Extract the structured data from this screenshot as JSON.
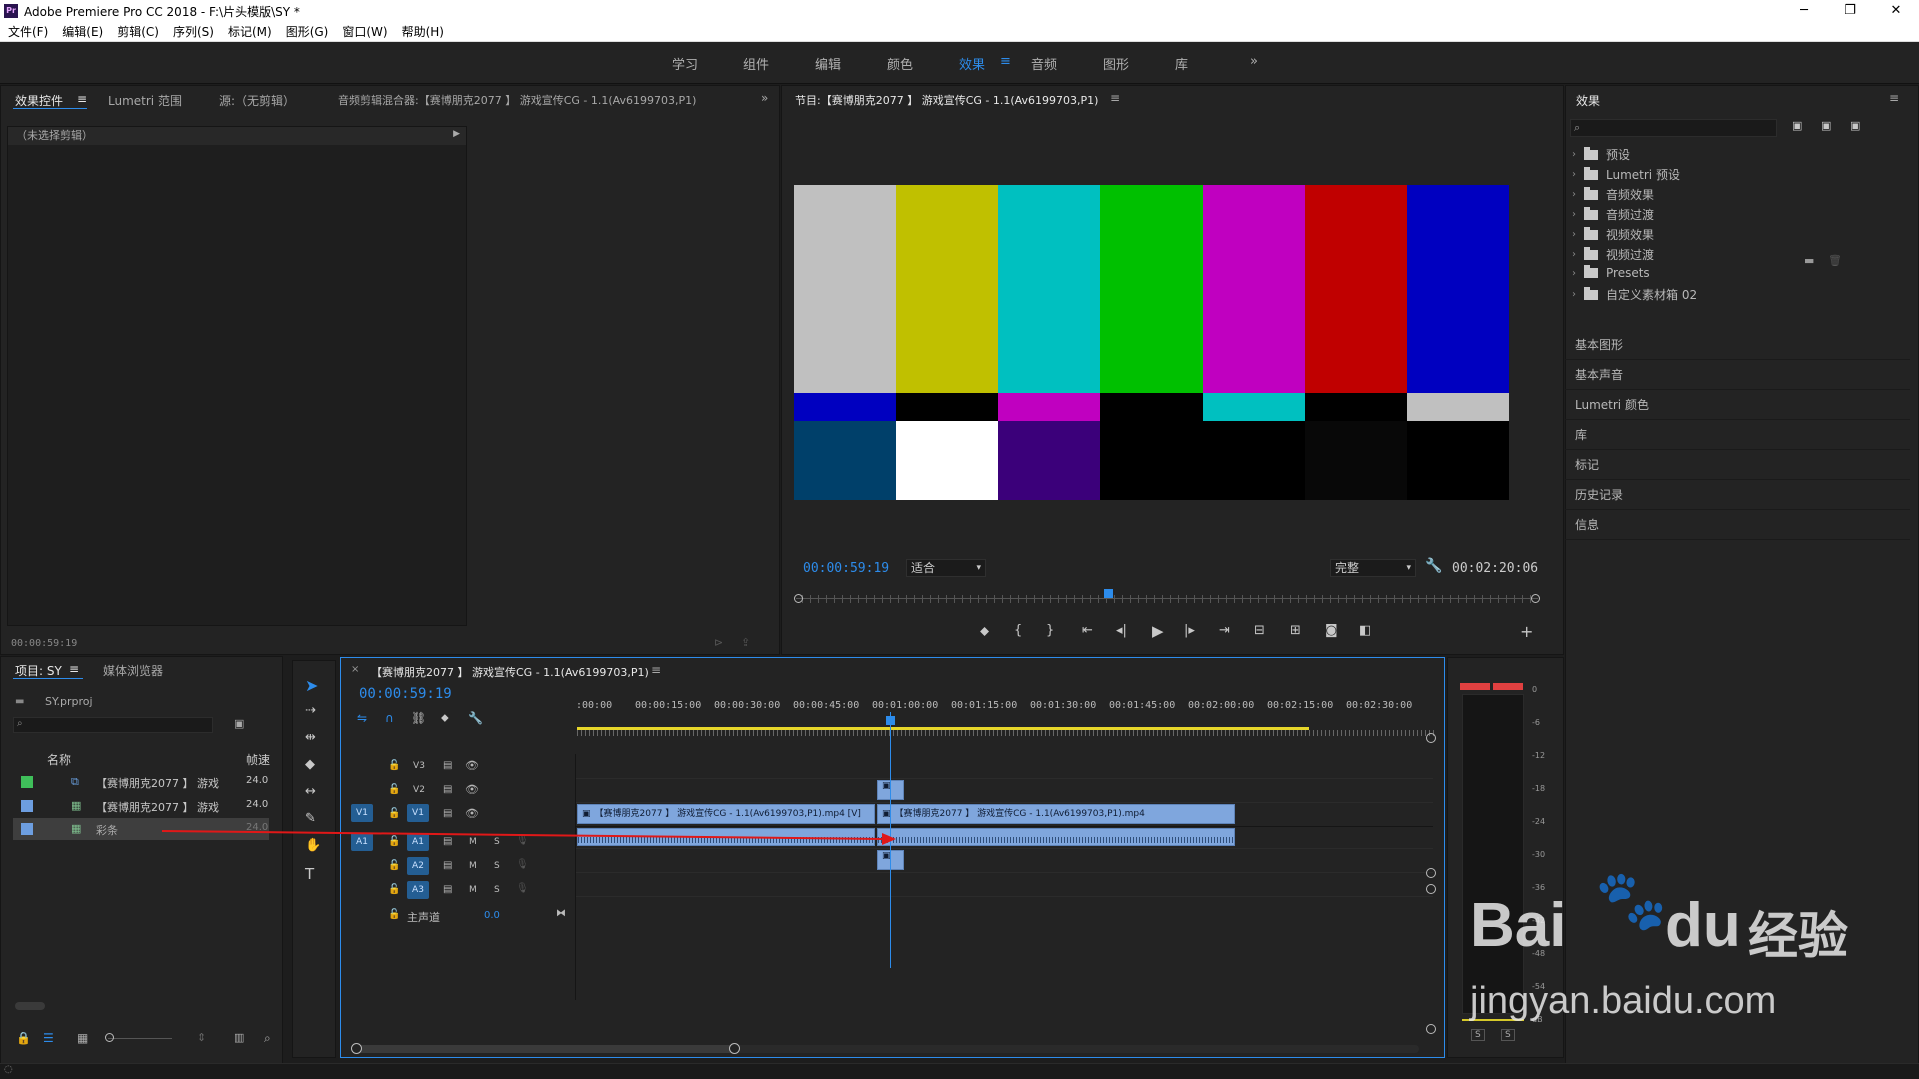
{
  "app": {
    "title": "Adobe Premiere Pro CC 2018 - F:\\片头模版\\SY *",
    "icon": "Pr"
  },
  "window_buttons": {
    "minimize": "─",
    "maximize": "❐",
    "close": "✕"
  },
  "menu": [
    "文件(F)",
    "编辑(E)",
    "剪辑(C)",
    "序列(S)",
    "标记(M)",
    "图形(G)",
    "窗口(W)",
    "帮助(H)"
  ],
  "workspaces": [
    "学习",
    "组件",
    "编辑",
    "颜色",
    "效果",
    "音频",
    "图形",
    "库"
  ],
  "workspace_active": "效果",
  "workspace_more": "»",
  "source_panel": {
    "tabs": [
      "效果控件",
      "Lumetri 范围",
      "源:（无剪辑）",
      "音频剪辑混合器:【赛博朋克2077 】 游戏宣传CG - 1.1(Av6199703,P1)"
    ],
    "no_clip": "（未选择剪辑）",
    "timecode": "00:00:59:19",
    "menu_icon": "≡",
    "more": "»"
  },
  "program": {
    "title": "节目:【赛博朋克2077 】 游戏宣传CG - 1.1(Av6199703,P1)",
    "timecode": "00:00:59:19",
    "zoom": "适合",
    "quality": "完整",
    "duration": "00:02:20:06",
    "playhead_fraction": 0.42,
    "color_bars_top": [
      "#c0c0c0",
      "#c0c000",
      "#00c0c0",
      "#00c000",
      "#c000c0",
      "#c00000",
      "#0000c0"
    ],
    "color_bars_mid": [
      "#0000c0",
      "#000000",
      "#c000c0",
      "#000000",
      "#00c0c0",
      "#000000",
      "#c0c0c0"
    ],
    "color_bars_bottom": [
      "#00406a",
      "#ffffff",
      "#3b007a",
      "#000000",
      "#000000",
      "#080808",
      "#000000"
    ]
  },
  "effects_panel": {
    "title": "效果",
    "items": [
      "预设",
      "Lumetri 预设",
      "音频效果",
      "音频过渡",
      "视频效果",
      "视频过渡",
      "Presets",
      "自定义素材箱 02"
    ],
    "sections": [
      "基本图形",
      "基本声音",
      "Lumetri 颜色",
      "库",
      "标记",
      "历史记录",
      "信息"
    ]
  },
  "project": {
    "tabs": [
      "项目: SY",
      "媒体浏览器"
    ],
    "file": "SY.prproj",
    "col_name": "名称",
    "col_fps": "帧速",
    "rows": [
      {
        "name": "【赛博朋克2077 】 游戏",
        "fps": "24.0",
        "color": "#3fbf5a"
      },
      {
        "name": "【赛博朋克2077 】 游戏",
        "fps": "24.0",
        "color": "#6d9ee0"
      },
      {
        "name": "彩条",
        "fps": "24.0",
        "color": "#6d9ee0"
      }
    ]
  },
  "timeline": {
    "title": "【赛博朋克2077 】 游戏宣传CG - 1.1(Av6199703,P1)",
    "timecode": "00:00:59:19",
    "ruler": [
      ":00:00",
      "00:00:15:00",
      "00:00:30:00",
      "00:00:45:00",
      "00:01:00:00",
      "00:01:15:00",
      "00:01:30:00",
      "00:01:45:00",
      "00:02:00:00",
      "00:02:15:00",
      "00:02:30:00"
    ],
    "tracks_video": [
      "V3",
      "V2",
      "V1"
    ],
    "tracks_audio": [
      "A1",
      "A2",
      "A3"
    ],
    "master": "主声道",
    "master_val": "0.0",
    "src_v": "V1",
    "src_a": "A1",
    "clip_v1a": "【赛博朋克2077 】 游戏宣传CG - 1.1(Av6199703,P1).mp4 [V]",
    "clip_v1b": "【赛博朋克2077 】 游戏宣传CG - 1.1(Av6199703,P1).mp4",
    "m": "M",
    "s": "S"
  },
  "meter": {
    "scale": [
      "0",
      "-6",
      "-12",
      "-18",
      "-24",
      "-30",
      "-36",
      "-42",
      "-48",
      "-54",
      "dB"
    ],
    "solo": "S"
  },
  "watermark": {
    "brand": "Bai",
    "brand2": "du",
    "cn": "经验",
    "url": "jingyan.baidu.com"
  }
}
